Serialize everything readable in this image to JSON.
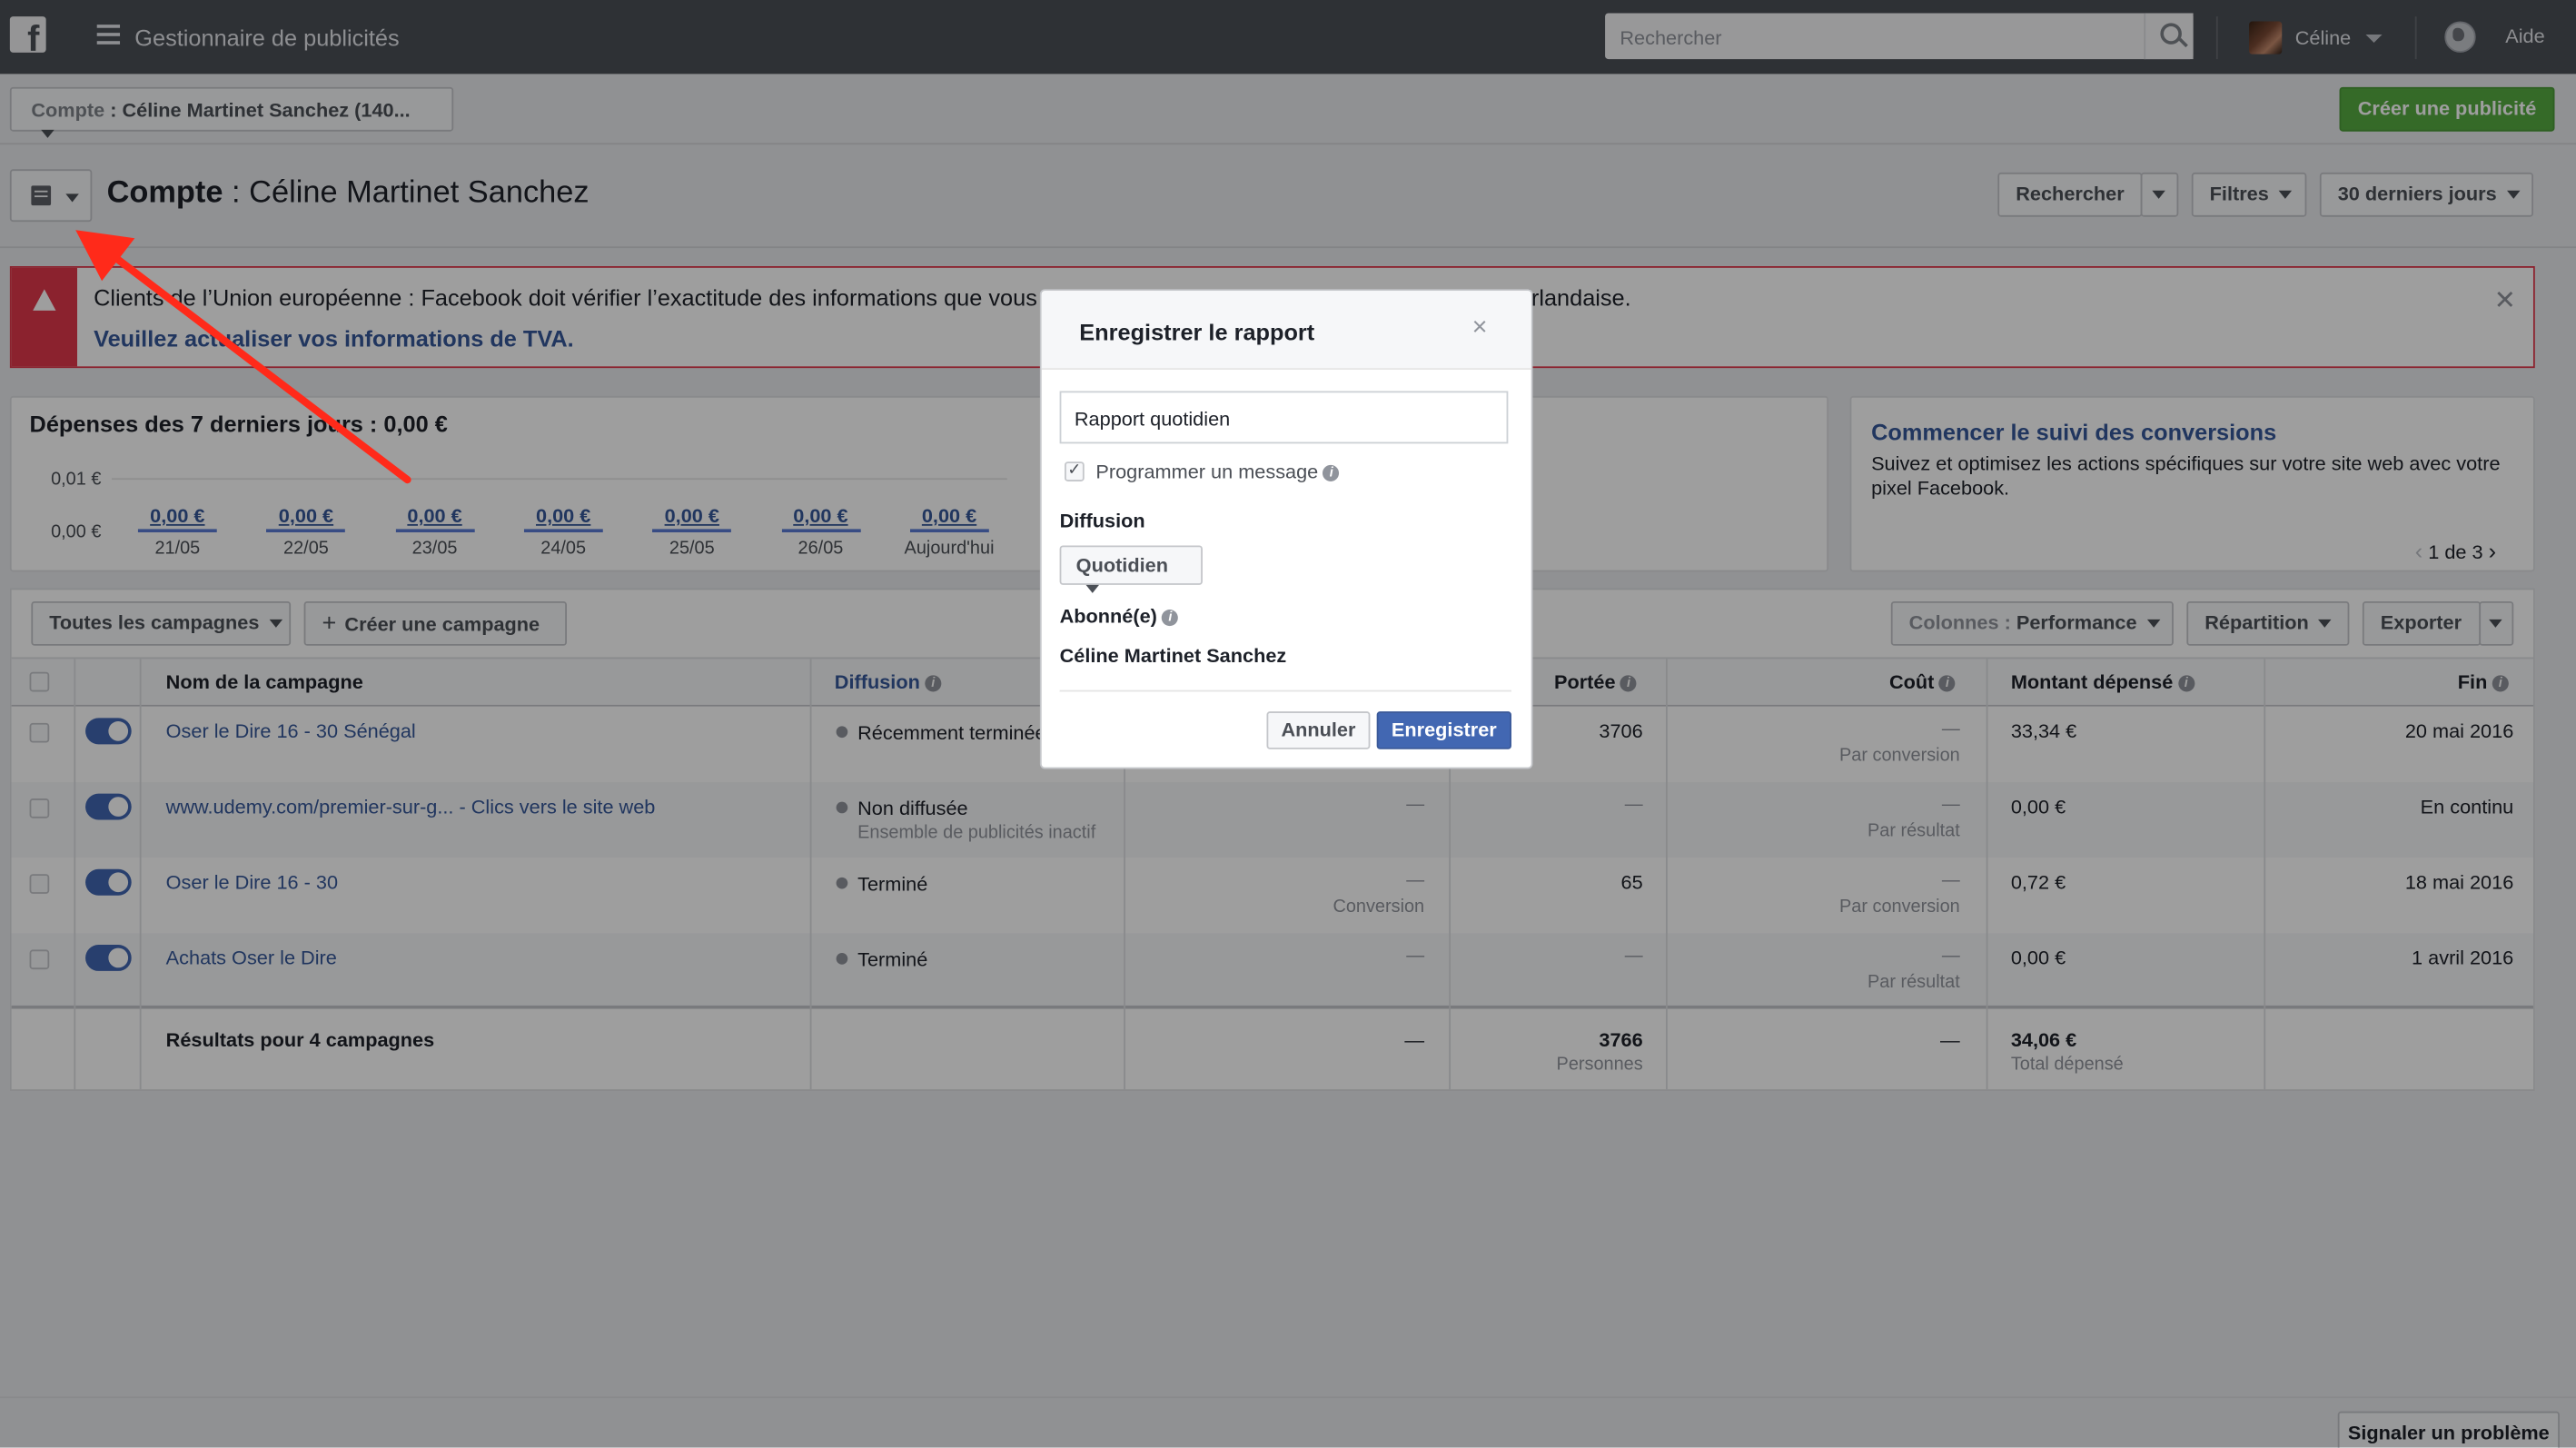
{
  "topbar": {
    "logo": "f",
    "app_title": "Gestionnaire de publicités",
    "search_placeholder": "Rechercher",
    "user_name": "Céline",
    "help": "Aide"
  },
  "account_bar": {
    "label": "Compte",
    "value": ": Céline Martinet Sanchez (140...",
    "create_ad": "Créer une publicité"
  },
  "page_header": {
    "title_bold": "Compte",
    "title_rest": " : Céline Martinet Sanchez",
    "search_btn": "Rechercher",
    "filters_btn": "Filtres",
    "date_btn": "30 derniers jours"
  },
  "alert": {
    "text": "Clients de l’Union européenne : Facebook doit vérifier l’exactitude des informations que vous f",
    "text_tail": "irlandaise.",
    "link": "Veuillez actualiser vos informations de TVA."
  },
  "spend": {
    "title": "Dépenses des 7 derniers jours : 0,00 €",
    "y_ticks": [
      "0,01 €",
      "0,00 €"
    ],
    "days": [
      {
        "value": "0,00 €",
        "date": "21/05"
      },
      {
        "value": "0,00 €",
        "date": "22/05"
      },
      {
        "value": "0,00 €",
        "date": "23/05"
      },
      {
        "value": "0,00 €",
        "date": "24/05"
      },
      {
        "value": "0,00 €",
        "date": "25/05"
      },
      {
        "value": "0,00 €",
        "date": "26/05"
      },
      {
        "value": "0,00 €",
        "date": "Aujourd'hui"
      }
    ]
  },
  "conversions": {
    "title": "Commencer le suivi des conversions",
    "text": "Suivez et optimisez les actions spécifiques sur votre site web avec votre pixel Facebook.",
    "pager": "1 de 3"
  },
  "table_toolbar": {
    "all_campaigns": "Toutes les campagnes",
    "create_campaign": "Créer une campagne",
    "columns_label": "Colonnes : ",
    "columns_value": "Performance",
    "breakdown": "Répartition",
    "export": "Exporter"
  },
  "table": {
    "headers": {
      "name": "Nom de la campagne",
      "delivery": "Diffusion",
      "reach": "Portée",
      "cost": "Coût",
      "spent": "Montant dépensé",
      "end": "Fin"
    },
    "rows": [
      {
        "name": "Oser le Dire 16 - 30 Sénégal",
        "delivery": "Récemment terminée",
        "delivery_sub": "",
        "results": "",
        "results_sub": "",
        "reach": "3706",
        "cost": "—",
        "cost_sub": "Par conversion",
        "spent": "33,34 €",
        "end": "20 mai 2016"
      },
      {
        "name": "www.udemy.com/premier-sur-g... - Clics vers le site web",
        "delivery": "Non diffusée",
        "delivery_sub": "Ensemble de publicités inactif",
        "results": "—",
        "results_sub": "",
        "reach": "—",
        "cost": "—",
        "cost_sub": "Par résultat",
        "spent": "0,00 €",
        "end": "En continu"
      },
      {
        "name": "Oser le Dire 16 - 30",
        "delivery": "Terminé",
        "delivery_sub": "",
        "results": "—",
        "results_sub": "Conversion",
        "reach": "65",
        "cost": "—",
        "cost_sub": "Par conversion",
        "spent": "0,72 €",
        "end": "18 mai 2016"
      },
      {
        "name": "Achats Oser le Dire",
        "delivery": "Terminé",
        "delivery_sub": "",
        "results": "—",
        "results_sub": "",
        "reach": "—",
        "cost": "—",
        "cost_sub": "Par résultat",
        "spent": "0,00 €",
        "end": "1 avril 2016"
      }
    ],
    "totals": {
      "label": "Résultats pour 4 campagnes",
      "results": "—",
      "reach": "3766",
      "reach_sub": "Personnes",
      "cost": "—",
      "spent": "34,06 €",
      "spent_sub": "Total dépensé"
    }
  },
  "modal": {
    "title": "Enregistrer le rapport",
    "close": "×",
    "report_name": "Rapport quotidien",
    "schedule_label": "Programmer un message",
    "delivery_label": "Diffusion",
    "delivery_value": "Quotidien",
    "subscribers_label": "Abonné(e)",
    "subscriber": "Céline Martinet Sanchez",
    "cancel": "Annuler",
    "save": "Enregistrer"
  },
  "footer": {
    "report_problem": "Signaler un problème"
  },
  "colors": {
    "topbar": "#4b4f56",
    "link": "#365899",
    "primary": "#4267b2",
    "success": "#56ab42",
    "alert": "#e0384b",
    "arrow": "#ff2a1a"
  }
}
